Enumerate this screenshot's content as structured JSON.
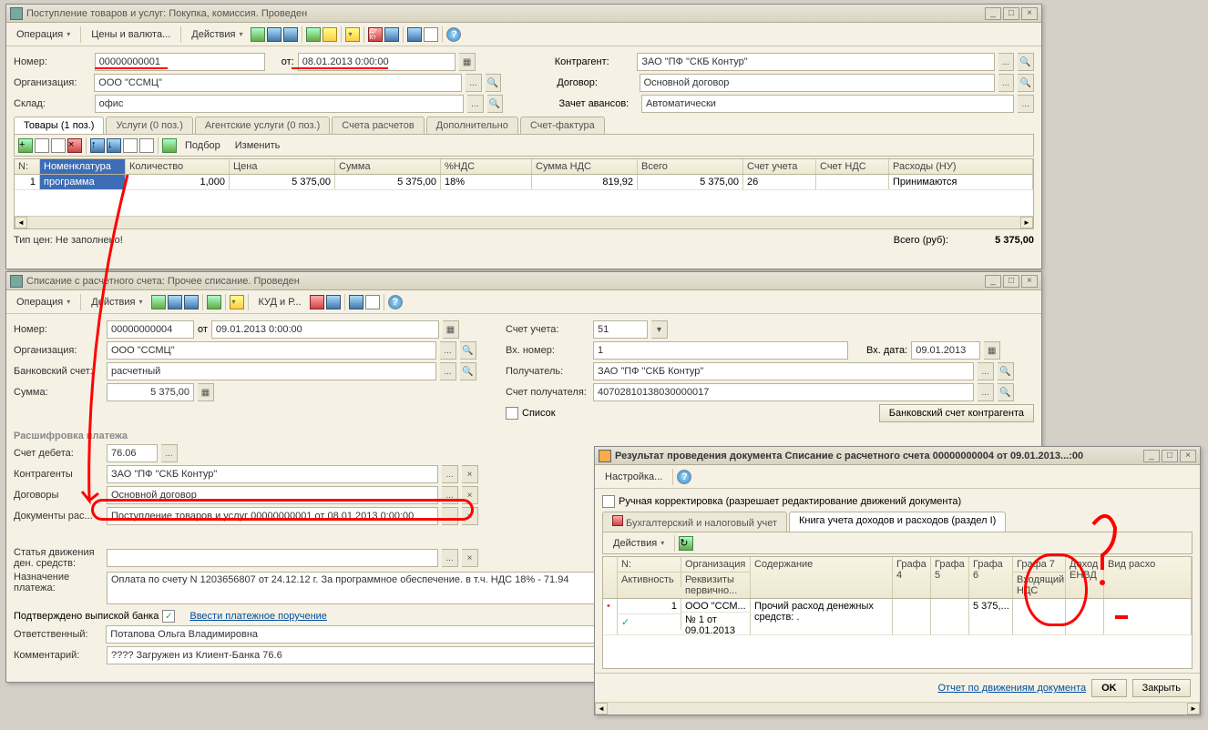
{
  "win1": {
    "title": "Поступление товаров и услуг: Покупка, комиссия. Проведен",
    "toolbar": {
      "op": "Операция",
      "prices": "Цены и валюта...",
      "actions": "Действия"
    },
    "f": {
      "num_l": "Номер:",
      "num": "00000000001",
      "ot": "от:",
      "date": "08.01.2013 0:00:00",
      "ka_l": "Контрагент:",
      "ka": "ЗАО \"ПФ \"СКБ Контур\"",
      "org_l": "Организация:",
      "org": "ООО \"ССМЦ\"",
      "dog_l": "Договор:",
      "dog": "Основной договор",
      "skl_l": "Склад:",
      "skl": "офис",
      "zav_l": "Зачет авансов:",
      "zav": "Автоматически"
    },
    "tabs": [
      "Товары (1 поз.)",
      "Услуги (0 поз.)",
      "Агентские услуги (0 поз.)",
      "Счета расчетов",
      "Дополнительно",
      "Счет-фактура"
    ],
    "gridbtns": {
      "podbor": "Подбор",
      "izm": "Изменить"
    },
    "headers": [
      "N:",
      "Номенклатура",
      "Количество",
      "Цена",
      "Сумма",
      "%НДС",
      "Сумма НДС",
      "Всего",
      "Счет учета",
      "Счет НДС",
      "Расходы (НУ)"
    ],
    "row": {
      "n": "1",
      "nom": "программа",
      "qty": "1,000",
      "price": "5 375,00",
      "sum": "5 375,00",
      "nds": "18%",
      "sumnds": "819,92",
      "total": "5 375,00",
      "acct": "26",
      "acctnds": "",
      "rash": "Принимаются"
    },
    "footer": {
      "tip": "Тип цен: Не заполнено!",
      "itogo": "Всего (руб):",
      "total": "5 375,00"
    }
  },
  "win2": {
    "title": "Списание с расчетного счета: Прочее списание. Проведен",
    "toolbar": {
      "op": "Операция",
      "actions": "Действия",
      "kud": "КУД и Р..."
    },
    "f": {
      "num_l": "Номер:",
      "num": "00000000004",
      "ot": "от",
      "date": "09.01.2013 0:00:00",
      "acct_l": "Счет учета:",
      "acct": "51",
      "org_l": "Организация:",
      "org": "ООО \"ССМЦ\"",
      "vn_l": "Вх. номер:",
      "vn": "1",
      "vd_l": "Вх. дата:",
      "vd": "09.01.2013",
      "bank_l": "Банковский счет:",
      "bank": "расчетный",
      "pol_l": "Получатель:",
      "pol": "ЗАО \"ПФ \"СКБ Контур\"",
      "sum_l": "Сумма:",
      "sum": "5 375,00",
      "sp_l": "Счет получателя:",
      "sp": "40702810138030000017",
      "list": "Список",
      "bsk": "Банковский счет контрагента"
    },
    "rsh": "Расшифровка платежа",
    "r": {
      "sd_l": "Счет дебета:",
      "sd": "76.06",
      "ka_l": "Контрагенты",
      "ka": "ЗАО \"ПФ \"СКБ Контур\"",
      "dog_l": "Договоры",
      "dog": "Основной договор",
      "dr_l": "Документы рас...",
      "dr": "Поступление товаров и услуг 00000000001 от 08.01.2013 0:00:00",
      "sdv_l": "Статья движения\nден. средств:",
      "sdv": "",
      "np_l": "Назначение\nплатежа:",
      "np": "Оплата по счету N 1203656807 от 24.12.12 г. За программное обеспечение. в т.ч. НДС 18% - 71.94",
      "pvb": "Подтверждено выпиской банка",
      "vpp": "Ввести платежное поручение",
      "otv_l": "Ответственный:",
      "otv": "Потапова Ольга Владимировна",
      "kom_l": "Комментарий:",
      "kom": "???? Загружен из Клиент-Банка 76.6"
    }
  },
  "win3": {
    "title": "Результат проведения документа Списание с расчетного счета 00000000004 от 09.01.2013...:00",
    "cfg": "Настройка...",
    "rk": "Ручная корректировка (разрешает редактирование движений документа)",
    "tabs": [
      "Бухгалтерский и налоговый учет",
      "Книга учета доходов и расходов (раздел I)"
    ],
    "act": "Действия",
    "h1": [
      "N:",
      "Организация",
      "Содержание",
      "Графа\n4",
      "Графа\n5",
      "Графа\n6",
      "Графа 7",
      "Доход\nЕНВД",
      "Вид расхо"
    ],
    "h2": [
      "Активность",
      "Реквизиты\nпервично...",
      "",
      "",
      "",
      "",
      "Входящий\nНДС",
      "",
      ""
    ],
    "row": {
      "n": "1",
      "org": "ООО \"ССМ...",
      "rek": "№ 1 от\n09.01.2013",
      "sod": "Прочий расход денежных\nсредств: .",
      "g4": "",
      "g5": "",
      "g6": "5 375,...",
      "g7": "",
      "enc": "",
      "vr": ""
    },
    "footer": {
      "rep": "Отчет по движениям документа",
      "ok": "OK",
      "close": "Закрыть"
    }
  }
}
